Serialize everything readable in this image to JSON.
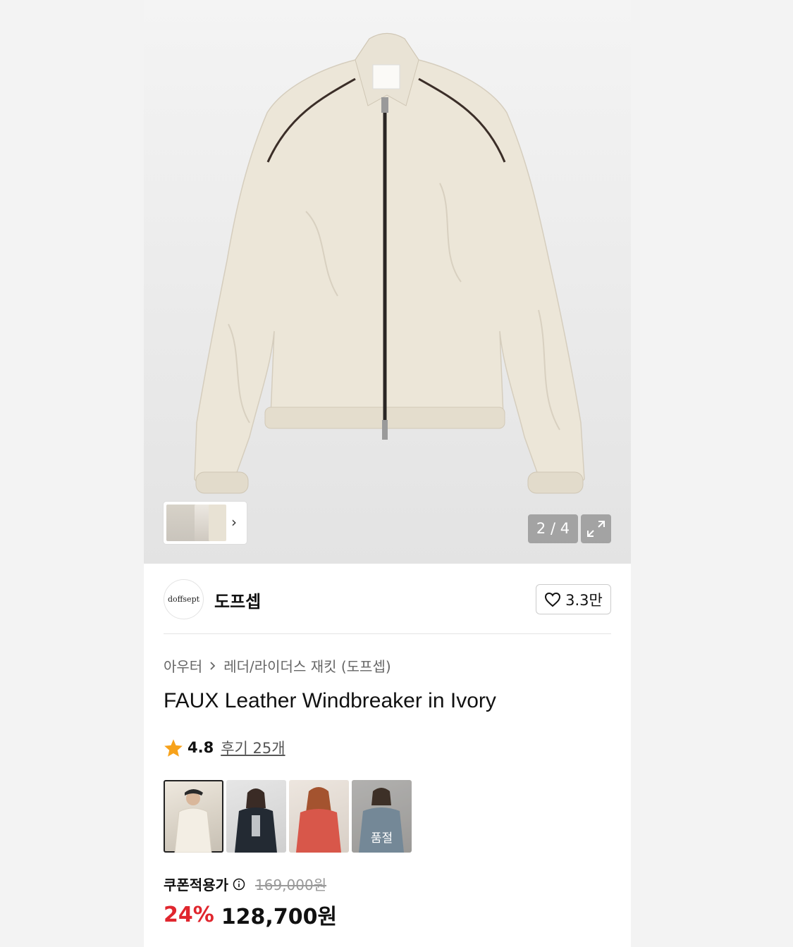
{
  "gallery": {
    "counter": "2 / 4",
    "strip_more": "›"
  },
  "brand": {
    "logo_text": "doffsept",
    "name": "도프셉",
    "likes": "3.3만"
  },
  "breadcrumb": {
    "category": "아우터",
    "subcategory": "레더/라이더스 재킷 (도프셉)"
  },
  "product": {
    "title": "FAUX Leather Windbreaker in Ivory",
    "rating": "4.8",
    "reviews": "후기 25개"
  },
  "colors": [
    {
      "name": "ivory",
      "selected": true,
      "soldout_label": ""
    },
    {
      "name": "black",
      "selected": false,
      "soldout_label": ""
    },
    {
      "name": "red",
      "selected": false,
      "soldout_label": ""
    },
    {
      "name": "blue",
      "selected": false,
      "soldout_label": "품절"
    }
  ],
  "price": {
    "coupon_label": "쿠폰적용가",
    "original": "169,000원",
    "discount": "24%",
    "final": "128,700원"
  },
  "accent": {
    "discount_color": "#e0262e",
    "star_color": "#f7a21b"
  }
}
